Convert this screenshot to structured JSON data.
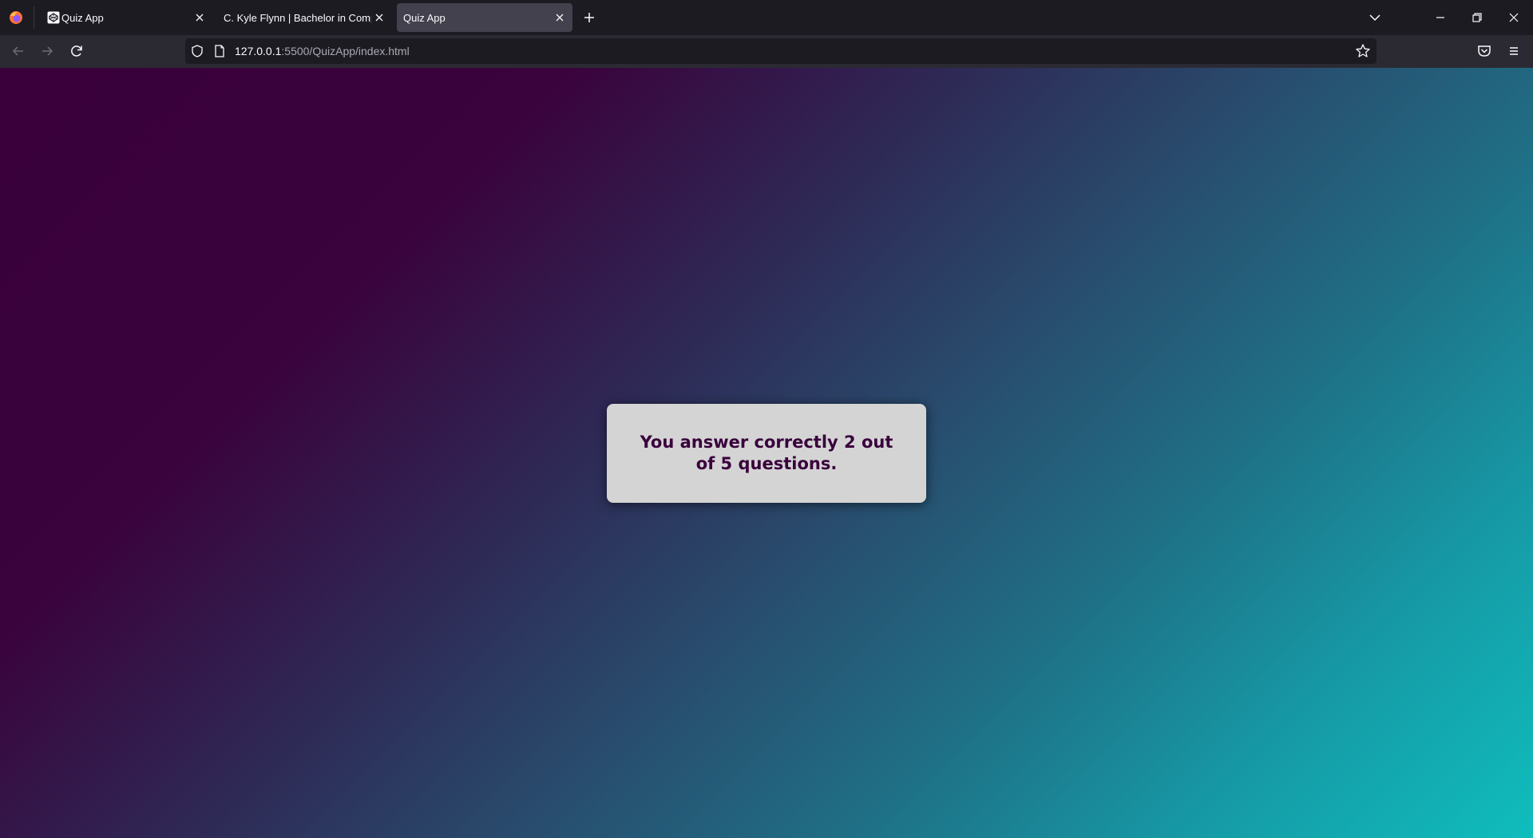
{
  "browser": {
    "tabs": [
      {
        "title": "Quiz App",
        "favicon": "codepen-icon",
        "active": false
      },
      {
        "title": "C. Kyle Flynn | Bachelor in Computer Science",
        "favicon": "",
        "active": false
      },
      {
        "title": "Quiz App",
        "favicon": "",
        "active": true
      }
    ],
    "url": {
      "host": "127.0.0.1",
      "rest": ":5500/QuizApp/index.html"
    },
    "icons": {
      "logo": "firefox-logo",
      "new_tab": "plus-icon",
      "tab_list": "chevron-down-icon",
      "minimize": "minimize-icon",
      "restore": "restore-icon",
      "close": "close-icon",
      "back": "back-arrow-icon",
      "forward": "forward-arrow-icon",
      "reload": "reload-icon",
      "shield": "shield-icon",
      "page": "page-icon",
      "bookmark": "star-icon",
      "pocket": "pocket-icon",
      "menu": "hamburger-menu-icon"
    }
  },
  "page": {
    "result_message": "You answer correctly 2 out of 5 questions.",
    "colors": {
      "gradient_start": "#39003c",
      "gradient_end": "#0fbdbd",
      "card_background": "#d4d4d4",
      "card_text": "#39003c"
    }
  }
}
